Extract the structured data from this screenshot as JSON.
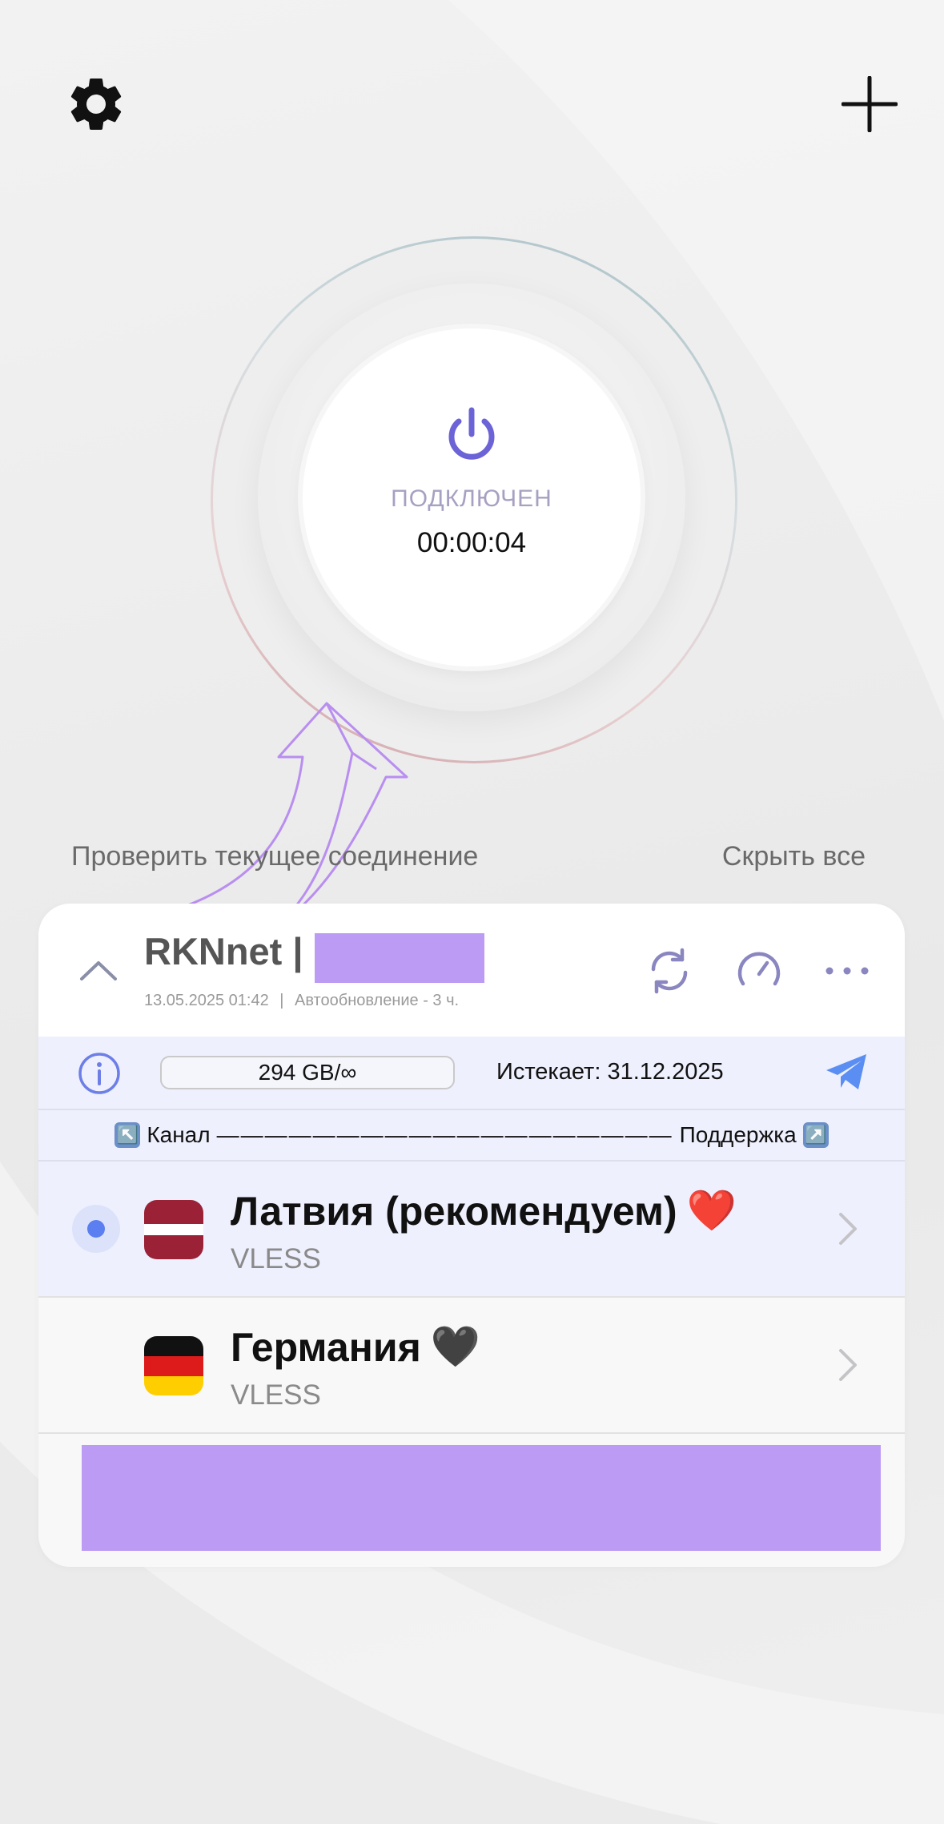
{
  "topbar": {
    "settings_icon": "gear-icon",
    "add_icon": "plus-icon"
  },
  "connection": {
    "status": "ПОДКЛЮЧЕН",
    "timer": "00:00:04",
    "power_icon": "power-icon"
  },
  "links": {
    "check_connection": "Проверить текущее соединение",
    "hide_all": "Скрыть все"
  },
  "subscription": {
    "name": "RKNnet |",
    "updated": "13.05.2025 01:42",
    "separator": "|",
    "auto_update": "Автообновление - 3 ч.",
    "traffic": "294 GB/∞",
    "expires": "Истекает: 31.12.2025",
    "channel_label": "Канал",
    "dashes": "———————————————————",
    "support_label": "Поддержка",
    "channel_emoji": "↖️",
    "support_emoji": "↗️"
  },
  "servers": [
    {
      "name": "Латвия (рекомендуем)",
      "emoji": "❤️",
      "protocol": "VLESS",
      "selected": true,
      "flag": "latvia-flag"
    },
    {
      "name": "Германия",
      "emoji": "🖤",
      "protocol": "VLESS",
      "selected": false,
      "flag": "germany-flag"
    }
  ],
  "colors": {
    "accent": "#6b63d6",
    "redaction": "#bb9bf4",
    "selected_row": "#eef0fd",
    "radio_dot": "#5b7ef0",
    "telegram_blue": "#5b8ef2",
    "annotation_arrow": "#b98ef0"
  }
}
